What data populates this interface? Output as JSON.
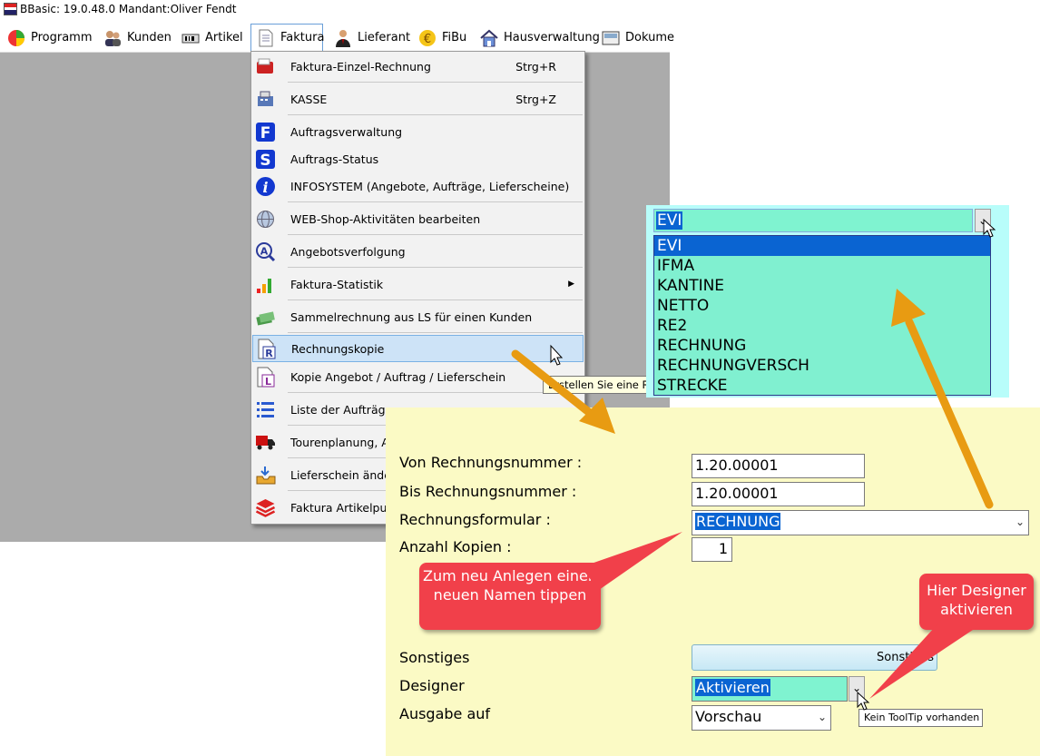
{
  "window": {
    "title": "BBasic: 19.0.48.0 Mandant:Oliver Fendt"
  },
  "menubar": {
    "items": [
      {
        "label": "Programm"
      },
      {
        "label": "Kunden"
      },
      {
        "label": "Artikel"
      },
      {
        "label": "Faktura"
      },
      {
        "label": "Lieferant"
      },
      {
        "label": "FiBu"
      },
      {
        "label": "Hausverwaltung"
      },
      {
        "label": "Dokume"
      }
    ]
  },
  "faktura_menu": {
    "items": [
      {
        "label": "Faktura-Einzel-Rechnung",
        "shortcut": "Strg+R"
      },
      {
        "label": "KASSE",
        "shortcut": "Strg+Z"
      },
      {
        "label": "Auftragsverwaltung"
      },
      {
        "label": "Auftrags-Status"
      },
      {
        "label": "INFOSYSTEM (Angebote, Aufträge, Lieferscheine)"
      },
      {
        "label": "WEB-Shop-Aktivitäten bearbeiten"
      },
      {
        "label": "Angebotsverfolgung"
      },
      {
        "label": "Faktura-Statistik"
      },
      {
        "label": "Sammelrechnung aus LS für einen Kunden"
      },
      {
        "label": "Rechnungskopie"
      },
      {
        "label": "Kopie Angebot / Auftrag / Lieferschein"
      },
      {
        "label": "Liste der Aufträge"
      },
      {
        "label": "Tourenplanung, Au"
      },
      {
        "label": "Lieferschein änder"
      },
      {
        "label": "Faktura Artikelpuff"
      }
    ],
    "tooltip": "Erstellen Sie eine Rec"
  },
  "formular_dropdown": {
    "current": "EVI",
    "options": [
      "EVI",
      "IFMA",
      "KANTINE",
      "NETTO",
      "RE2",
      "RECHNUNG",
      "RECHNUNGVERSCH",
      "STRECKE"
    ]
  },
  "form": {
    "von_label": "Von Rechnungsnummer :",
    "von_value": "1.20.00001",
    "bis_label": "Bis Rechnungsnummer :",
    "bis_value": "1.20.00001",
    "formular_label": "Rechnungsformular :",
    "formular_value": "RECHNUNG",
    "kopien_label": "Anzahl Kopien :",
    "kopien_value": "1",
    "sonstiges_label": "Sonstiges",
    "sonstiges_button": "Sonstiges",
    "designer_label": "Designer",
    "designer_value": "Aktivieren",
    "ausgabe_label": "Ausgabe auf",
    "ausgabe_value": "Vorschau",
    "designer_tooltip": "Kein ToolTip vorhanden"
  },
  "annotations": {
    "callout_name": "Zum neu Anlegen einen neuen Namen tippen",
    "callout_designer": "Hier Designer aktivieren",
    "arrow_color": "#f5a623",
    "callout_color": "#f1404a"
  }
}
